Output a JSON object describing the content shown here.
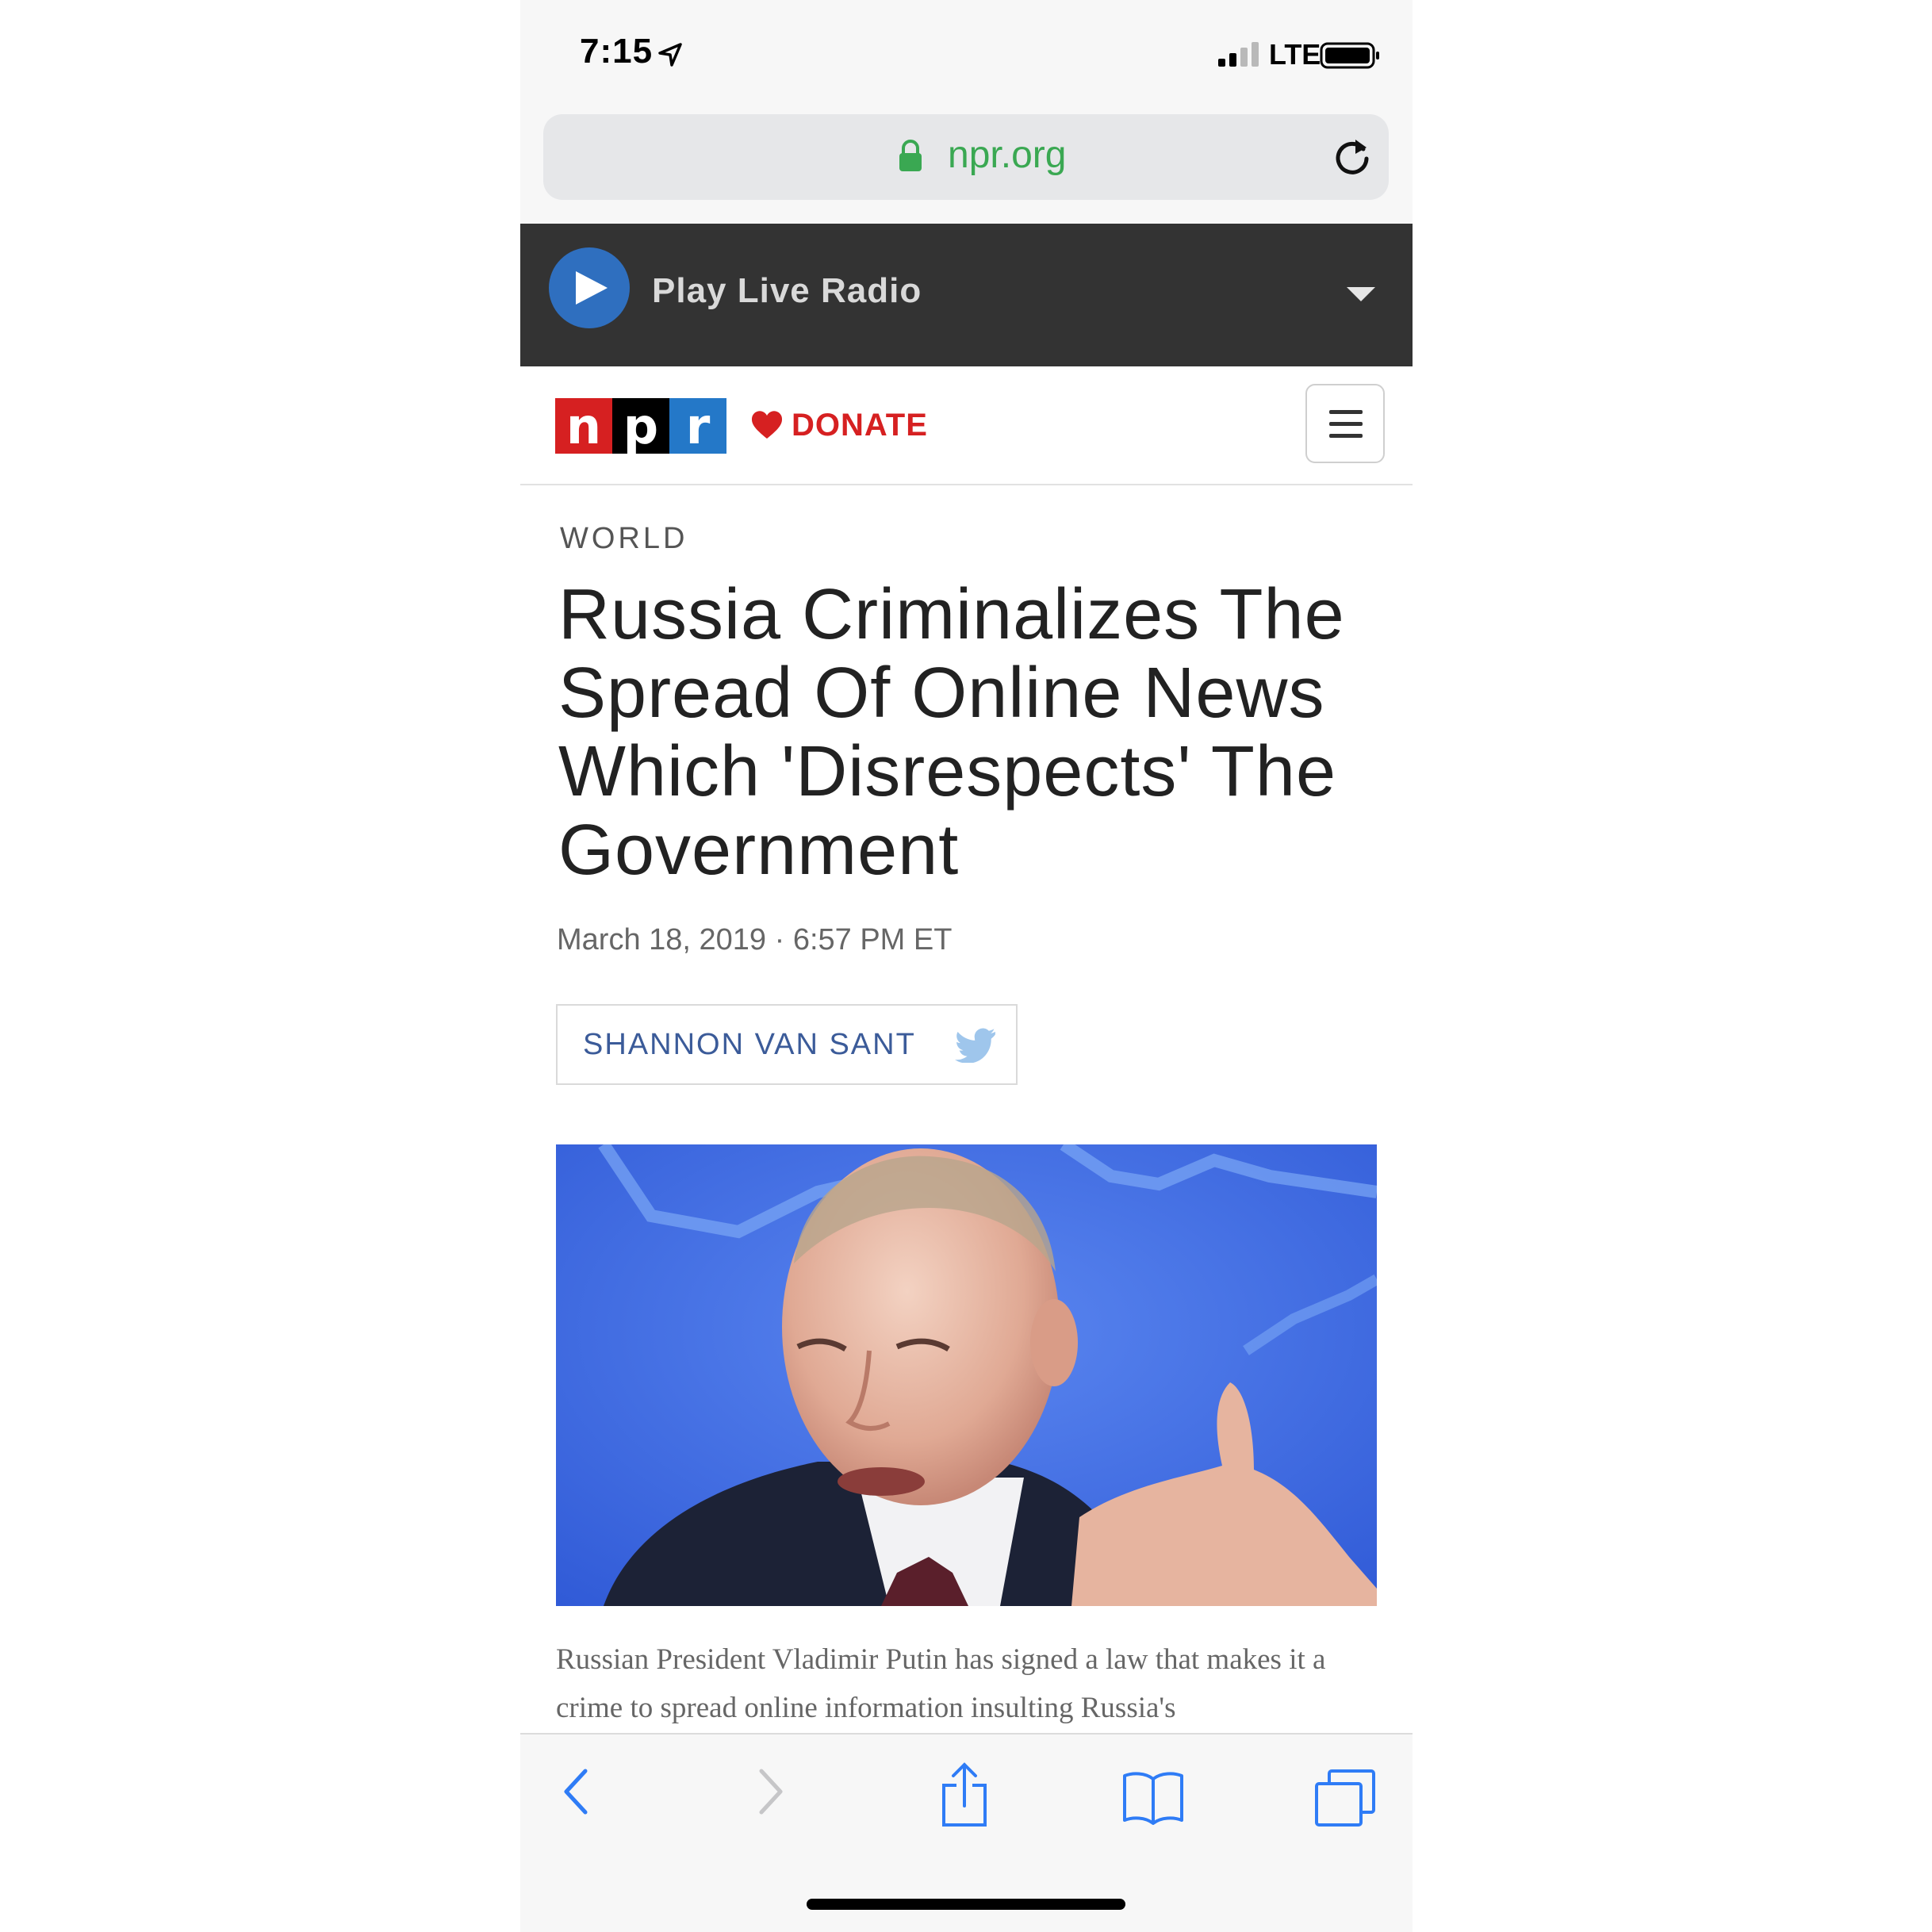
{
  "status_bar": {
    "time": "7:15",
    "network": "LTE",
    "icons": [
      "location-arrow-icon",
      "signal-icon",
      "battery-icon"
    ]
  },
  "browser": {
    "url": "npr.org",
    "url_color": "#3aa852",
    "icons": [
      "lock-icon",
      "reload-icon"
    ]
  },
  "radio": {
    "label": "Play Live Radio",
    "icons": [
      "play-icon",
      "chevron-down-icon"
    ]
  },
  "header": {
    "logo_letters": [
      "n",
      "p",
      "r"
    ],
    "logo_colors": [
      "#d62021",
      "#000000",
      "#2478c8"
    ],
    "donate_label": "DONATE",
    "icons": [
      "heart-icon",
      "hamburger-menu-icon"
    ]
  },
  "article": {
    "section": "WORLD",
    "headline": "Russia Criminalizes The Spread Of Online News Which 'Disrespects' The Government",
    "dateline": "March 18, 2019 · 6:57 PM ET",
    "author": "SHANNON VAN SANT",
    "caption": "Russian President Vladimir Putin has signed a law that makes it a crime to spread online information insulting Russia's"
  },
  "toolbar": {
    "icons": [
      "back-icon",
      "forward-icon",
      "share-icon",
      "bookmarks-icon",
      "tabs-icon"
    ]
  }
}
